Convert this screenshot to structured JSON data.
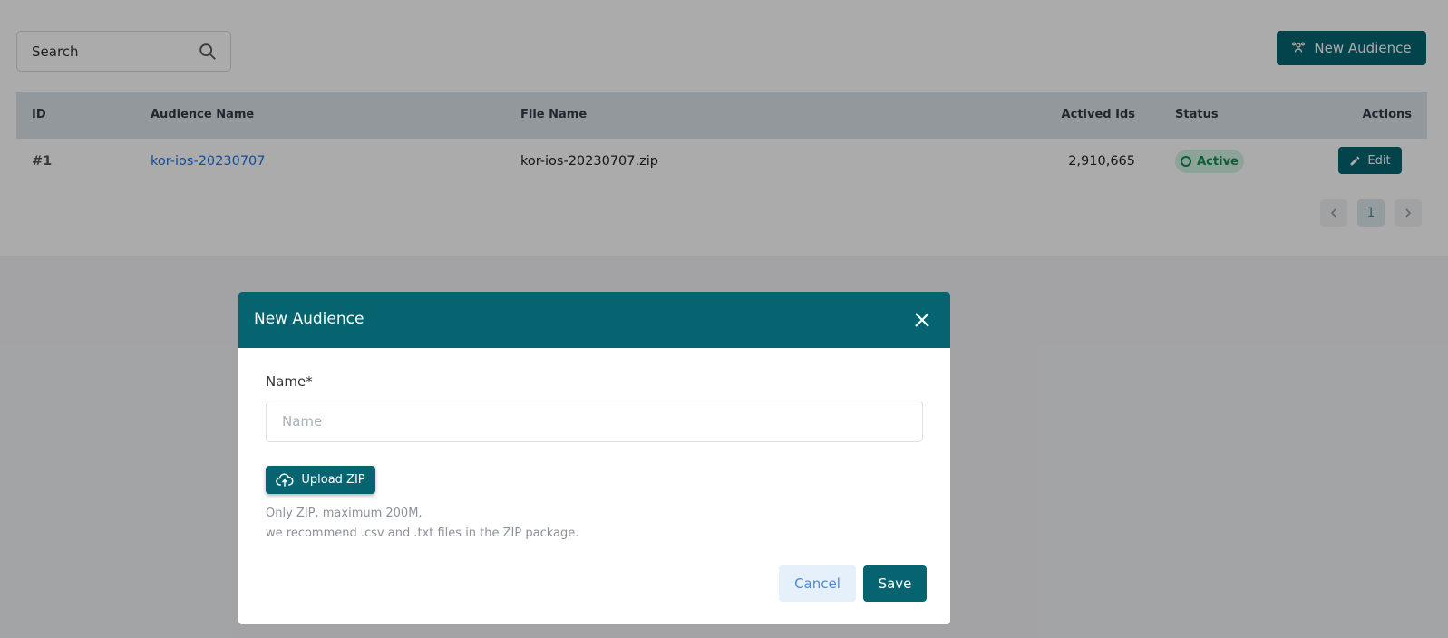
{
  "toolbar": {
    "search_label": "Search",
    "new_audience_label": "New Audience"
  },
  "table": {
    "headers": [
      "ID",
      "Audience Name",
      "File Name",
      "Actived Ids",
      "Status",
      "Actions"
    ],
    "rows": [
      {
        "id": "#1",
        "audience_name": "kor-ios-20230707",
        "file_name": "kor-ios-20230707.zip",
        "actived_ids": "2,910,665",
        "status": "Active",
        "action": "Edit"
      }
    ]
  },
  "pagination": {
    "current_page": "1"
  },
  "modal": {
    "title": "New Audience",
    "name_label": "Name*",
    "name_placeholder": "Name",
    "name_value": "",
    "upload_label": "Upload ZIP",
    "hint_line1": "Only ZIP, maximum 200M,",
    "hint_line2": "we recommend .csv and .txt files in the ZIP package.",
    "cancel_label": "Cancel",
    "save_label": "Save"
  },
  "colors": {
    "primary": "#056470",
    "status_active_bg": "#d3f2e3",
    "status_active_text": "#138a4f",
    "link": "#1a73e8"
  }
}
